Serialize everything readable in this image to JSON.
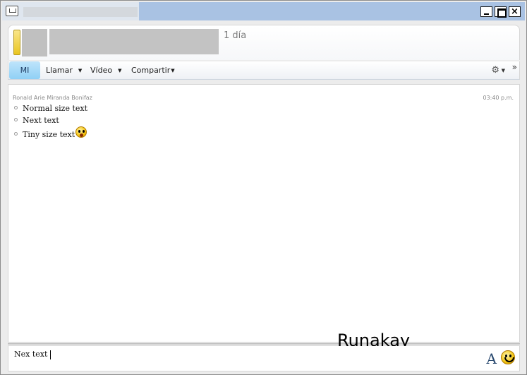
{
  "header": {
    "status_text": "1 día"
  },
  "toolbar": {
    "mi_label": "MI",
    "call_label": "Llamar",
    "video_label": "Vídeo",
    "share_label": "Compartir",
    "more_glyph": "»"
  },
  "conversation": {
    "sender": "Ronald Arie Miranda Bonifaz",
    "time": "03:40 p.m.",
    "messages": [
      {
        "text": "Normal size text"
      },
      {
        "text": "Next text"
      },
      {
        "text": "Tiny size text"
      }
    ]
  },
  "watermark": "Runakay",
  "input": {
    "value": "Nex text"
  },
  "icons": {
    "app": "chat-icon",
    "font": "font-icon",
    "emoticon": "smiley-icon",
    "surprised": "surprised-emoticon-icon",
    "settings": "settings-icon"
  },
  "colors": {
    "titlebar": "#a9c2e3",
    "mi_tab": "#8fd0f5",
    "status_indicator": "#e9c520"
  }
}
